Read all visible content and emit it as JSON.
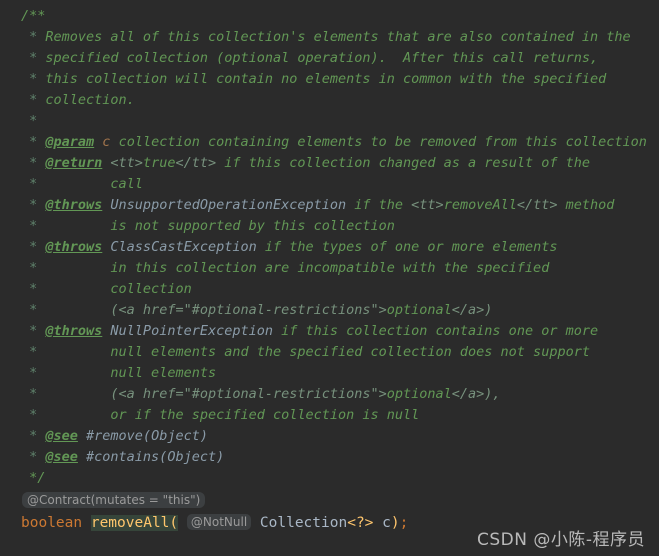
{
  "editor": {
    "theme": "Darcula",
    "background_color": "#2b2b2b",
    "language": "Java"
  },
  "javadoc": {
    "open": "/**",
    "close": " */",
    "lines": [
      {
        "asterisk": " * ",
        "text": "Removes all of this collection's elements that are also contained in the"
      },
      {
        "asterisk": " * ",
        "text": "specified collection (optional operation).  After this call returns,"
      },
      {
        "asterisk": " * ",
        "text": "this collection will contain no elements in common with the specified"
      },
      {
        "asterisk": " * ",
        "text": "collection."
      },
      {
        "asterisk": " *",
        "text": ""
      },
      {
        "asterisk": " * ",
        "tag": "@param",
        "param": " c",
        "text": " collection containing elements to be removed from this collection"
      },
      {
        "asterisk": " * ",
        "tag": "@return",
        "markup_open": " <tt>",
        "code": "true",
        "markup_close": "</tt>",
        "text": " if this collection changed as a result of the"
      },
      {
        "asterisk": " * ",
        "indent": "        ",
        "text": "call"
      },
      {
        "asterisk": " * ",
        "tag": "@throws",
        "type": " UnsupportedOperationException",
        "text": " if the ",
        "markup_open": "<tt>",
        "code": "removeAll",
        "markup_close": "</tt>",
        "text2": " method"
      },
      {
        "asterisk": " * ",
        "indent": "        ",
        "text": "is not supported by this collection"
      },
      {
        "asterisk": " * ",
        "tag": "@throws",
        "type": " ClassCastException",
        "text": " if the types of one or more elements"
      },
      {
        "asterisk": " * ",
        "indent": "        ",
        "text": "in this collection are incompatible with the specified"
      },
      {
        "asterisk": " * ",
        "indent": "        ",
        "text": "collection"
      },
      {
        "asterisk": " * ",
        "indent": "        ",
        "markup": "(<a href=\"#optional-restrictions\">",
        "text": "optional",
        "markup_end": "</a>)"
      },
      {
        "asterisk": " * ",
        "tag": "@throws",
        "type": " NullPointerException",
        "text": " if this collection contains one or more"
      },
      {
        "asterisk": " * ",
        "indent": "        ",
        "text": "null elements and the specified collection does not support"
      },
      {
        "asterisk": " * ",
        "indent": "        ",
        "text": "null elements"
      },
      {
        "asterisk": " * ",
        "indent": "        ",
        "markup": "(<a href=\"#optional-restrictions\">",
        "text": "optional",
        "markup_end": "</a>),"
      },
      {
        "asterisk": " * ",
        "indent": "        ",
        "text": "or if the specified collection is null"
      },
      {
        "asterisk": " * ",
        "tag": "@see",
        "ref": " #remove(",
        "type": "Object",
        "ref_close": ")"
      },
      {
        "asterisk": " * ",
        "tag": "@see",
        "ref": " #contains(",
        "type": "Object",
        "ref_close": ")"
      }
    ]
  },
  "inlay_hints": {
    "contract": "@Contract(mutates = \"this\")",
    "not_null": "@NotNull"
  },
  "signature": {
    "return_type": "boolean",
    "method_name": "removeAll",
    "open_paren": "(",
    "param_type": "Collection",
    "generic": "<?>",
    "param_name": " c",
    "close_paren": ")",
    "semicolon": ";"
  },
  "watermark": {
    "text": "CSDN @小陈-程序员"
  },
  "colors": {
    "background": "#2b2b2b",
    "javadoc_text": "#629755",
    "javadoc_asterisk": "#5f826b",
    "javadoc_type": "#8a9ba8",
    "javadoc_param": "#a1744c",
    "keyword": "#cc7832",
    "method": "#ffc66d",
    "identifier": "#a9b7c6",
    "inlay_bg": "#3c3f41",
    "inlay_text": "#9a9a9a",
    "method_highlight": "#36453a"
  }
}
